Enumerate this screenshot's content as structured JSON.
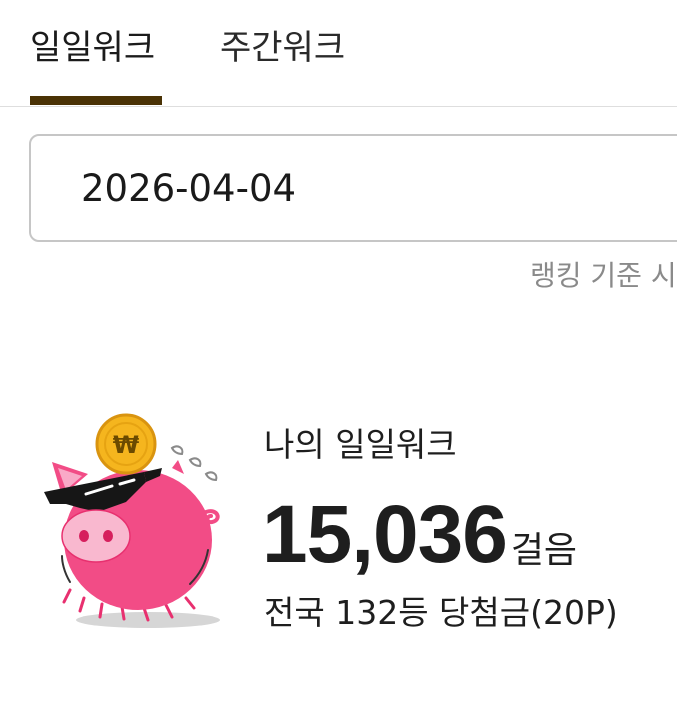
{
  "tabs": [
    {
      "label": "일일워크",
      "selected": true
    },
    {
      "label": "주간워크",
      "selected": false
    }
  ],
  "colors": {
    "accent": "#4a3205",
    "pig": "#f24c86",
    "coin": "#f5b51e"
  },
  "date_field": {
    "value": "2026-04-04"
  },
  "ranking_note": "랭킹 기준 시",
  "summary": {
    "label": "나의 일일워크",
    "steps": "15,036",
    "unit": "걸음",
    "rank_text": "전국 132등 당첨금(20P)",
    "coin_symbol": "₩",
    "mascot_icon": "piggy-bank-icon"
  }
}
